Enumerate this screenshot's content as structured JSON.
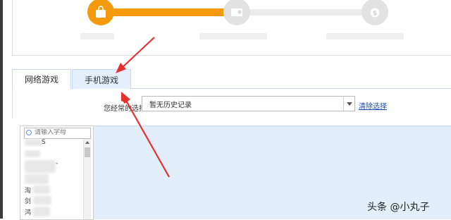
{
  "tabs": [
    {
      "label": "网络游戏"
    },
    {
      "label": "手机游戏"
    }
  ],
  "history": {
    "label": "您经常的选择是:",
    "value": "暂无历史记录",
    "clear_label": "清除选择"
  },
  "search": {
    "placeholder": "请输入字母"
  },
  "game_list": {
    "visible_chars": [
      "S",
      "-",
      "淘",
      "剑",
      "鸿"
    ]
  },
  "watermark": "头条 @小丸子",
  "colors": {
    "accent": "#f59a0d",
    "tab_active_bg": "#e4effb",
    "content_bg": "#e3eefb",
    "annotation_arrow": "#e53030",
    "link": "#1b4fb0"
  },
  "icons": {
    "step_1": "shopping-bag-icon",
    "step_2": "card-icon",
    "step_3": "money-bag-icon"
  }
}
